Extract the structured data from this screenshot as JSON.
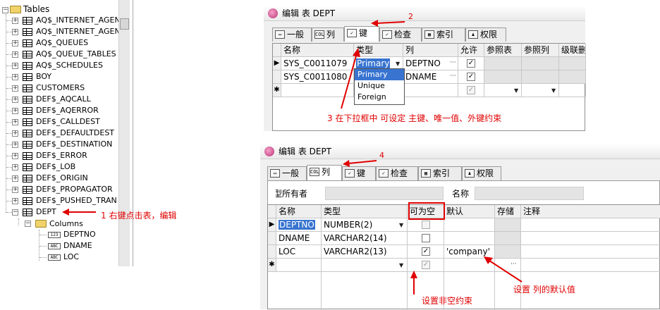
{
  "tree": {
    "root_label": "Tables",
    "tables": [
      "AQ$_INTERNET_AGEN",
      "AQ$_INTERNET_AGEN",
      "AQ$_QUEUES",
      "AQ$_QUEUE_TABLES",
      "AQ$_SCHEDULES",
      "BOY",
      "CUSTOMERS",
      "DEF$_AQCALL",
      "DEF$_AQERROR",
      "DEF$_CALLDEST",
      "DEF$_DEFAULTDEST",
      "DEF$_DESTINATION",
      "DEF$_ERROR",
      "DEF$_LOB",
      "DEF$_ORIGIN",
      "DEF$_PROPAGATOR",
      "DEF$_PUSHED_TRAN",
      "DEPT"
    ],
    "columns_folder": "Columns",
    "columns": [
      {
        "label": "DEPTNO",
        "type_icon": "123"
      },
      {
        "label": "DNAME",
        "type_icon": "ABC"
      },
      {
        "label": "LOC",
        "type_icon": "ABC"
      }
    ]
  },
  "dialog1": {
    "title": "编辑 表 DEPT",
    "tabs": [
      {
        "label": "一般",
        "icon": "general-icon"
      },
      {
        "label": "列",
        "icon": "columns-icon"
      },
      {
        "label": "键",
        "icon": "key-icon"
      },
      {
        "label": "检查",
        "icon": "check-icon"
      },
      {
        "label": "索引",
        "icon": "index-icon"
      },
      {
        "label": "权限",
        "icon": "privileges-icon"
      }
    ],
    "headers": [
      "名称",
      "类型",
      "列",
      "允许",
      "参照表",
      "参照列",
      "级联删"
    ],
    "rows": [
      {
        "name": "SYS_C0011079",
        "type": "Primary",
        "column": "DEPTNO",
        "enabled": true
      },
      {
        "name": "SYS_C0011080",
        "type": "",
        "column": "DNAME",
        "enabled": true
      }
    ],
    "type_options": [
      "Primary",
      "Unique",
      "Foreign"
    ],
    "type_selected": "Primary"
  },
  "dialog2": {
    "title": "编辑 表 DEPT",
    "tabs": [
      {
        "label": "一般",
        "icon": "general-icon"
      },
      {
        "label": "列",
        "icon": "columns-icon"
      },
      {
        "label": "键",
        "icon": "key-icon"
      },
      {
        "label": "检查",
        "icon": "check-icon"
      },
      {
        "label": "索引",
        "icon": "index-icon"
      },
      {
        "label": "权限",
        "icon": "privileges-icon"
      }
    ],
    "owner_label": "所有者",
    "owner_prefix": "类型",
    "name_label": "名称",
    "headers": [
      "名称",
      "类型",
      "可为空",
      "默认",
      "存储",
      "注释"
    ],
    "rows": [
      {
        "name": "DEPTNO",
        "type": "NUMBER(2)",
        "nullable": false,
        "default": ""
      },
      {
        "name": "DNAME",
        "type": "VARCHAR2(14)",
        "nullable": false,
        "default": ""
      },
      {
        "name": "LOC",
        "type": "VARCHAR2(13)",
        "nullable": true,
        "default": "'company'"
      }
    ]
  },
  "annotations": {
    "a1": "1  右键点击表，编辑",
    "a2": "2",
    "a3": "3  在下拉框中  可设定  主键、唯一值、外键约束",
    "a4": "4",
    "a5": "设置非空约束",
    "a6": "设置  列的默认值"
  },
  "colors": {
    "annotation": "#e00000",
    "selection": "#3874d0"
  }
}
